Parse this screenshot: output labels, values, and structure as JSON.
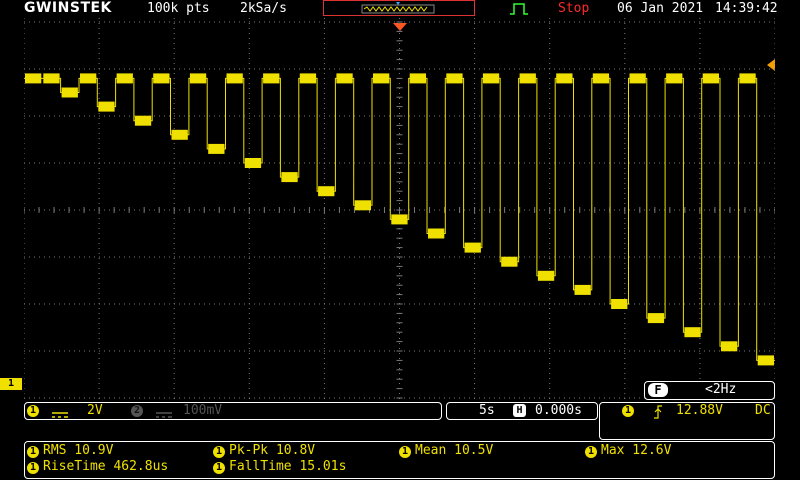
{
  "topbar": {
    "brand": "GWINSTEK",
    "record_length": "100k pts",
    "sample_rate": "2kSa/s",
    "state": "Stop",
    "date": "06 Jan 2021",
    "time": "14:39:42"
  },
  "channel1": {
    "id": "1",
    "coupling_icon": "dc-coupling-icon",
    "scale": "2V"
  },
  "channel2": {
    "id": "2",
    "coupling_icon": "dc-coupling-icon",
    "scale": "100mV"
  },
  "timebase": {
    "scale": "5s",
    "position_icon": "h-position-icon",
    "position": "0.000s"
  },
  "trigger": {
    "source": "1",
    "slope_icon": "rising-edge-icon",
    "level": "12.88V",
    "coupling": "DC",
    "filter_key": "F",
    "frequency": "<2Hz"
  },
  "measurements": {
    "rms": "RMS 10.9V",
    "pkpk": "Pk-Pk 10.8V",
    "mean": "Mean 10.5V",
    "max": "Max 12.6V",
    "rise": "RiseTime 462.8us",
    "fall": "FallTime 15.01s"
  },
  "colors": {
    "ch1": "#f0e000",
    "stop": "#ff2a2a",
    "trigger_marker": "#ff5522",
    "grid": "#7a7a7a"
  },
  "chart_data": {
    "type": "line",
    "series": [
      {
        "values_div_from_center": [
          2.8,
          2.8,
          2.5,
          2.8,
          2.2,
          2.8,
          1.9,
          2.8,
          1.6,
          2.8,
          1.3,
          2.8,
          1.0,
          2.8,
          0.7,
          2.8,
          0.4,
          2.8,
          0.1,
          2.8,
          -0.2,
          2.8,
          -0.5,
          2.8,
          -0.8,
          2.8,
          -1.1,
          2.8,
          -1.4,
          2.8,
          -1.7,
          2.8,
          -2.0,
          2.8,
          -2.3,
          2.8,
          -2.6,
          2.8,
          -2.9,
          2.8,
          -3.2
        ]
      }
    ],
    "grid": true
  }
}
